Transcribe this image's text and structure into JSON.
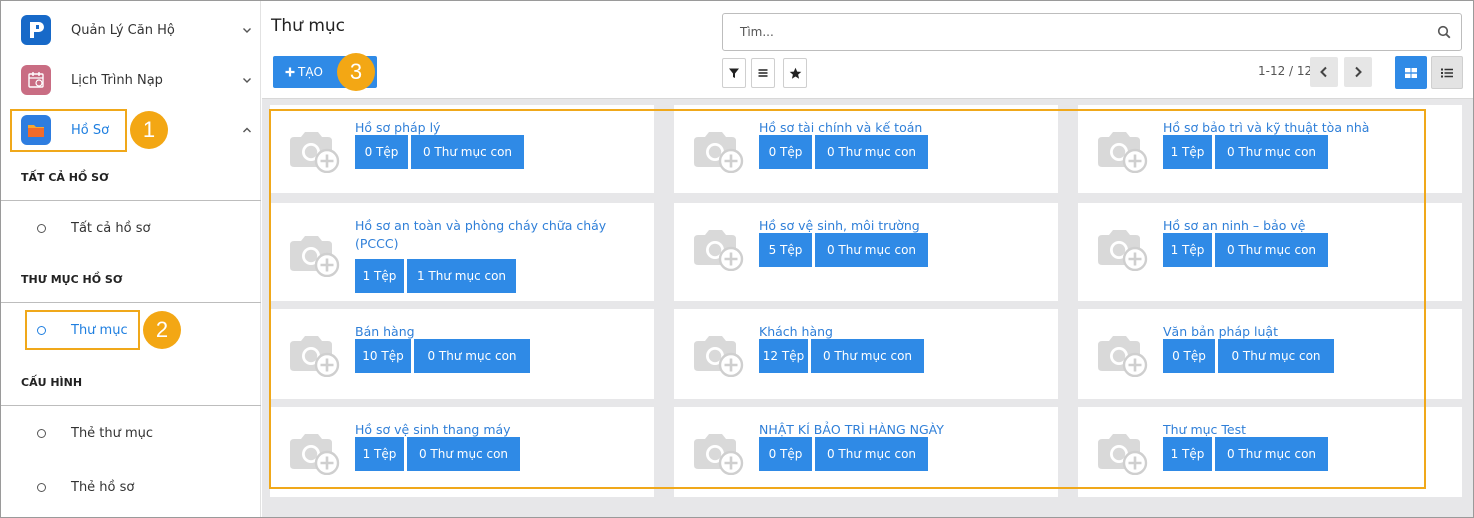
{
  "sidebar": {
    "apps": [
      {
        "label": "Quản Lý Căn Hộ",
        "icon": "app-logo-icon"
      },
      {
        "label": "Lịch Trình Nạp",
        "icon": "calendar-app-icon"
      },
      {
        "label": "Hồ Sơ",
        "icon": "folder-app-icon"
      }
    ],
    "sections": [
      {
        "title": "TẤT CẢ HỒ SƠ",
        "items": [
          "Tất cả hồ sơ"
        ]
      },
      {
        "title": "THƯ MỤC HỒ SƠ",
        "items": [
          "Thư mục"
        ]
      },
      {
        "title": "CẤU HÌNH",
        "items": [
          "Thẻ thư mục",
          "Thẻ hồ sơ"
        ]
      }
    ]
  },
  "annotations": [
    "1",
    "2",
    "3"
  ],
  "header": {
    "title": "Thư mục",
    "create_label": "TẠO",
    "search_placeholder": "Tìm...",
    "pager": "1-12 / 12"
  },
  "folders": [
    {
      "name": "Hồ sơ pháp lý",
      "files": "0 Tệp",
      "subfolders": "0 Thư mục con"
    },
    {
      "name": "Hồ sơ tài chính và kế toán",
      "files": "0 Tệp",
      "subfolders": "0 Thư mục con"
    },
    {
      "name": "Hồ sơ bảo trì và kỹ thuật tòa nhà",
      "files": "1 Tệp",
      "subfolders": "0 Thư mục con"
    },
    {
      "name": "Hồ sơ an toàn và phòng cháy chữa cháy (PCCC)",
      "files": "1 Tệp",
      "subfolders": "1 Thư mục con"
    },
    {
      "name": "Hồ sơ vệ sinh, môi trường",
      "files": "5 Tệp",
      "subfolders": "0 Thư mục con"
    },
    {
      "name": "Hồ sơ an ninh – bảo vệ",
      "files": "1 Tệp",
      "subfolders": "0 Thư mục con"
    },
    {
      "name": "Bán hàng",
      "files": "10 Tệp",
      "subfolders": "0 Thư mục con"
    },
    {
      "name": "Khách hàng",
      "files": "12 Tệp",
      "subfolders": "0 Thư mục con"
    },
    {
      "name": "Văn bản pháp luật",
      "files": "0 Tệp",
      "subfolders": "0 Thư mục con"
    },
    {
      "name": "Hồ sơ vệ sinh thang máy",
      "files": "1 Tệp",
      "subfolders": "0 Thư mục con"
    },
    {
      "name": "NHẬT KÍ BẢO TRÌ HÀNG NGÀY",
      "files": "0 Tệp",
      "subfolders": "0 Thư mục con"
    },
    {
      "name": "Thư mục Test",
      "files": "1 Tệp",
      "subfolders": "0 Thư mục con"
    }
  ],
  "colors": {
    "accent": "#2f8ae6",
    "link": "#2f7fd8",
    "annotation": "#f0a81a"
  }
}
